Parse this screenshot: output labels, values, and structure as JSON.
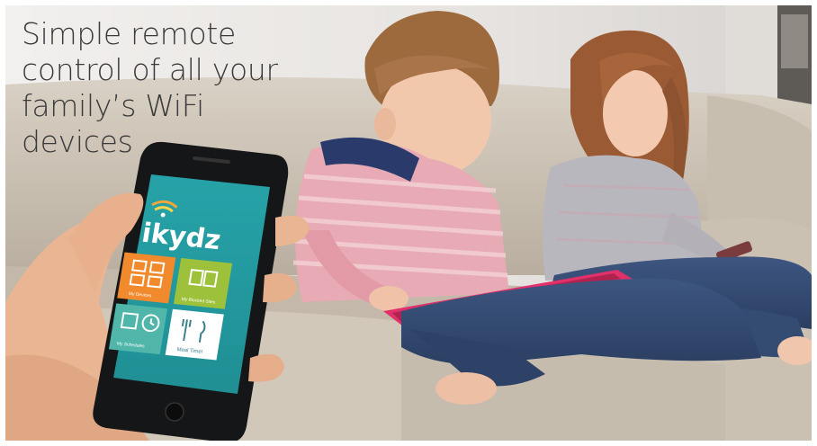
{
  "headline": {
    "lines": [
      "Simple remote",
      "control of all your",
      "family’s WiFi",
      "devices"
    ]
  },
  "app": {
    "name": "ikydz",
    "tiles": [
      {
        "label": "My Devices",
        "icon": "devices-icon",
        "color": "#f08a2c"
      },
      {
        "label": "My Blocked Sites",
        "icon": "blocked-sites-icon",
        "color": "#9dc13a"
      },
      {
        "label": "My Schedules",
        "icon": "calendar-clock-icon",
        "color": "#4fb6a9"
      },
      {
        "label": "Meal Time!",
        "icon": "meal-time-icon",
        "color": "#ffffff"
      }
    ]
  },
  "colors": {
    "app_background": "#2aa1a6",
    "sofa": "#cfc6b8",
    "wall": "#e7e4e1"
  }
}
